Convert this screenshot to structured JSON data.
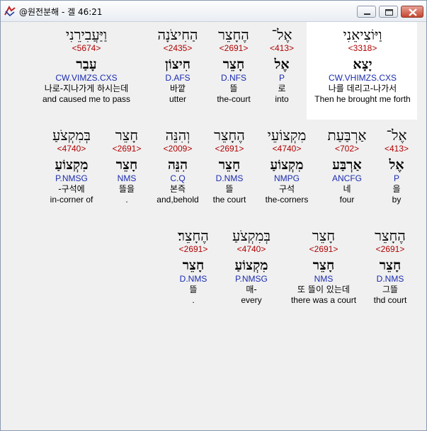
{
  "window": {
    "title": "@원전분해 - 겔 46:21",
    "buttons": {
      "minimize": "minimize-button",
      "maximize": "maximize-button",
      "close": "close-button"
    }
  },
  "colors": {
    "strong": "#b00000",
    "parse": "#1a2bb0",
    "highlight": "#ffffff",
    "background": "#f0f0f0"
  },
  "rows": [
    {
      "words": [
        {
          "heb": "וַיּוֹצִיאֵנִי",
          "strong": "<3318>",
          "lemma": "יָצָא",
          "parse": "CW.VHIMZS.CXS",
          "kor": "나를 데리고-나가서",
          "eng": "Then he brought me forth",
          "highlighted": true
        },
        {
          "heb": "אֶל־",
          "strong": "<413>",
          "lemma": "אֶל",
          "parse": "P",
          "kor": "로",
          "eng": "into"
        },
        {
          "heb": "הֶחָצֵר",
          "strong": "<2691>",
          "lemma": "חָצֵר",
          "parse": "D.NFS",
          "kor": "뜰",
          "eng": "the-court"
        },
        {
          "heb": "הַחִיצֹנָה",
          "strong": "<2435>",
          "lemma": "חִיצוֹן",
          "parse": "D.AFS",
          "kor": "바깥",
          "eng": "utter"
        },
        {
          "heb": "וַיַּעֲבִירֵנִי",
          "strong": "<5674>",
          "lemma": "עָבַר",
          "parse": "CW.VIMZS.CXS",
          "kor": "나로-지나가게 하시는데",
          "eng": "and caused me to pass"
        }
      ]
    },
    {
      "words": [
        {
          "heb": "אֶל־",
          "strong": "<413>",
          "lemma": "אֶל",
          "parse": "P",
          "kor": "을",
          "eng": "by"
        },
        {
          "heb": "אַרְבַּעַת",
          "strong": "<702>",
          "lemma": "אַרְבַּע",
          "parse": "ANCFG",
          "kor": "네",
          "eng": "four"
        },
        {
          "heb": "מִקְצוֹעֵי",
          "strong": "<4740>",
          "lemma": "מִקְצוֹעַ",
          "parse": "NMPG",
          "kor": "구석",
          "eng": "the-corners"
        },
        {
          "heb": "הֶחָצֵר",
          "strong": "<2691>",
          "lemma": "חָצֵר",
          "parse": "D.NMS",
          "kor": "뜰",
          "eng": "the court"
        },
        {
          "heb": "וְהִנֵּה",
          "strong": "<2009>",
          "lemma": "הִנֵּה",
          "parse": "C.Q",
          "kor": "본즉",
          "eng": "and,behold"
        },
        {
          "heb": "חָצֵר",
          "strong": "<2691>",
          "lemma": "חָצֵר",
          "parse": "NMS",
          "kor": "뜰을",
          "eng": "."
        },
        {
          "heb": "בְּמִקְצֹעַ",
          "strong": "<4740>",
          "lemma": "מִקְצוֹעַ",
          "parse": "P.NMSG",
          "kor": "-구석에",
          "eng": "in-corner of"
        }
      ]
    },
    {
      "words": [
        {
          "heb": "הֶחָצֵר",
          "strong": "<2691>",
          "lemma": "חָצֵר",
          "parse": "D.NMS",
          "kor": "그뜰",
          "eng": "thd court"
        },
        {
          "heb": "חָצֵר",
          "strong": "<2691>",
          "lemma": "חָצֵר",
          "parse": "NMS",
          "kor": "또 뜰이 있는데",
          "eng": "there was a court"
        },
        {
          "heb": "בְּמִקְצֹעַ",
          "strong": "<4740>",
          "lemma": "מִקְצוֹעַ",
          "parse": "P.NMSG",
          "kor": "매-",
          "eng": "every"
        },
        {
          "heb": "הֶחָצֵר׃",
          "strong": "<2691>",
          "lemma": "חָצֵר",
          "parse": "D.NMS",
          "kor": "뜰",
          "eng": "."
        }
      ]
    }
  ]
}
